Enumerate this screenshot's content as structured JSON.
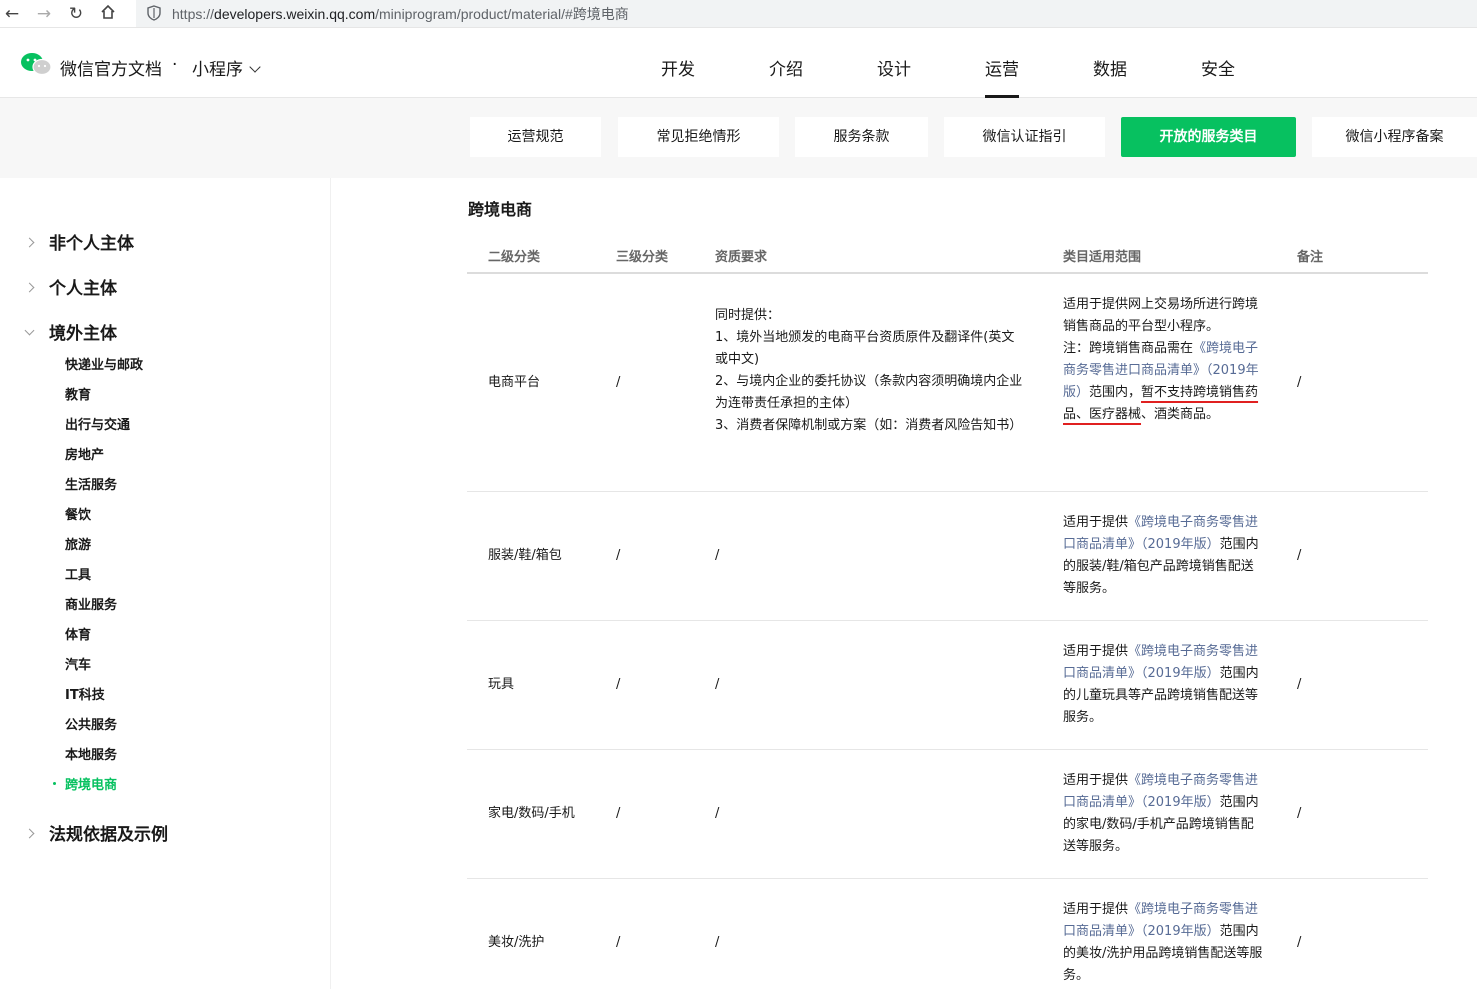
{
  "browser": {
    "url_prefix": "https://",
    "url_host": "developers.weixin.qq.com",
    "url_path": "/miniprogram/product/material/#跨境电商"
  },
  "header": {
    "site_title": "微信官方文档",
    "separator": "·",
    "product": "小程序",
    "nav": [
      {
        "label": "开发"
      },
      {
        "label": "介绍"
      },
      {
        "label": "设计"
      },
      {
        "label": "运营",
        "active": true
      },
      {
        "label": "数据"
      },
      {
        "label": "安全"
      }
    ]
  },
  "subnav": [
    {
      "label": "运营规范"
    },
    {
      "label": "常见拒绝情形"
    },
    {
      "label": "服务条款"
    },
    {
      "label": "微信认证指引"
    },
    {
      "label": "开放的服务类目",
      "active": true
    },
    {
      "label": "微信小程序备案"
    }
  ],
  "sidebar": {
    "groups": [
      {
        "label": "非个人主体",
        "open": false
      },
      {
        "label": "个人主体",
        "open": false
      },
      {
        "label": "境外主体",
        "open": true
      },
      {
        "label": "法规依据及示例",
        "open": false
      }
    ],
    "sub_items": [
      "快递业与邮政",
      "教育",
      "出行与交通",
      "房地产",
      "生活服务",
      "餐饮",
      "旅游",
      "工具",
      "商业服务",
      "体育",
      "汽车",
      "IT科技",
      "公共服务",
      "本地服务",
      "跨境电商"
    ],
    "active_item": "跨境电商"
  },
  "main": {
    "title": "跨境电商",
    "columns": [
      "二级分类",
      "三级分类",
      "资质要求",
      "类目适用范围",
      "备注"
    ],
    "rows": [
      {
        "category": "电商平台",
        "level3": "/",
        "qual": [
          "同时提供：",
          "1、境外当地颁发的电商平台资质原件及翻译件(英文或中文)",
          "2、与境内企业的委托协议（条款内容须明确境内企业为连带责任承担的主体）",
          "3、消费者保障机制或方案（如：消费者风险告知书）"
        ],
        "scope_a": "适用于提供网上交易场所进行跨境销售商品的平台型小程序。",
        "scope_b": "注：跨境销售商品需在",
        "scope_link": "《跨境电子商务零售进口商品清单》（2019年版）",
        "scope_c": "范围内，",
        "scope_red": "暂不支持跨境销售药品、医疗器械",
        "scope_d": "、酒类商品。",
        "note": "/"
      },
      {
        "category": "服装/鞋/箱包",
        "level3": "/",
        "qual_single": "/",
        "scope_pre": "适用于提供",
        "scope_link": "《跨境电子商务零售进口商品清单》（2019年版）",
        "scope_post": "范围内的服装/鞋/箱包产品跨境销售配送等服务。",
        "note": "/"
      },
      {
        "category": "玩具",
        "level3": "/",
        "qual_single": "/",
        "scope_pre": "适用于提供",
        "scope_link": "《跨境电子商务零售进口商品清单》（2019年版）",
        "scope_post": "范围内的儿童玩具等产品跨境销售配送等服务。",
        "note": "/"
      },
      {
        "category": "家电/数码/手机",
        "level3": "/",
        "qual_single": "/",
        "scope_pre": "适用于提供",
        "scope_link": "《跨境电子商务零售进口商品清单》（2019年版）",
        "scope_post": "范围内的家电/数码/手机产品跨境销售配送等服务。",
        "note": "/"
      },
      {
        "category": "美妆/洗护",
        "level3": "/",
        "qual_single": "/",
        "scope_pre": "适用于提供",
        "scope_link": "《跨境电子商务零售进口商品清单》（2019年版）",
        "scope_post": "范围内的美妆/洗护用品跨境销售配送等服务。",
        "note": "/"
      }
    ]
  },
  "colors": {
    "brand_green": "#07c160",
    "link": "#576b95",
    "annotation_red": "#e02020"
  }
}
